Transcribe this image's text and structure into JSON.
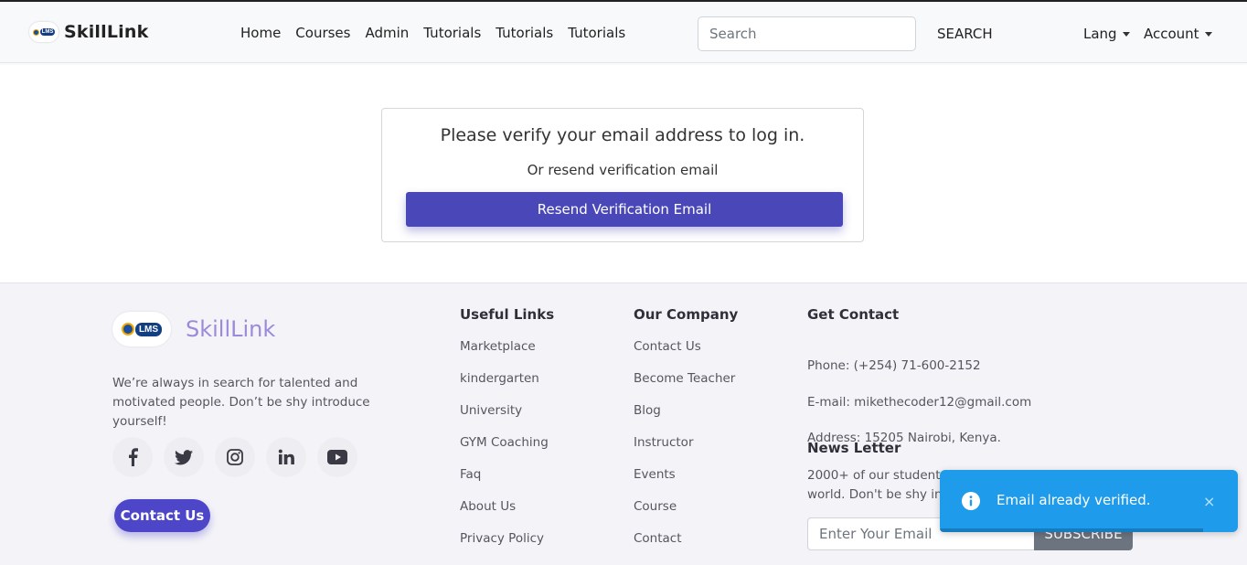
{
  "navbar": {
    "brand": "SkillLink",
    "logo_text": "LMS",
    "links": [
      "Home",
      "Courses",
      "Admin",
      "Tutorials",
      "Tutorials",
      "Tutorials"
    ],
    "search_placeholder": "Search",
    "search_button": "SEARCH",
    "lang_label": "Lang",
    "account_label": "Account"
  },
  "verify": {
    "title": "Please verify your email address to log in.",
    "subtitle": "Or resend verification email",
    "button": "Resend Verification Email"
  },
  "footer": {
    "brand": "SkillLink",
    "logo_text": "LMS",
    "tagline": "We’re always in search for talented and motivated people. Don’t be shy introduce yourself!",
    "socials": [
      "facebook-icon",
      "twitter-icon",
      "instagram-icon",
      "linkedin-icon",
      "youtube-icon"
    ],
    "contact_button": "Contact Us",
    "useful_links": {
      "title": "Useful Links",
      "items": [
        "Marketplace",
        "kindergarten",
        "University",
        "GYM Coaching",
        "Faq",
        "About Us",
        "Privacy Policy"
      ]
    },
    "our_company": {
      "title": "Our Company",
      "items": [
        "Contact Us",
        "Become Teacher",
        "Blog",
        "Instructor",
        "Events",
        "Course",
        "Contact"
      ]
    },
    "get_contact": {
      "title": "Get Contact",
      "phone": "Phone: (+254) 71-600-2152",
      "email": "E-mail: mikethecoder12@gmail.com",
      "address": "Address: 15205 Nairobi, Kenya."
    },
    "newsletter": {
      "title": "News Letter",
      "text": "2000+ of our students are subscribed around the world. Don't be shy introduce yourself!",
      "placeholder": "Enter Your Email",
      "button": "SUBSCRIBE"
    }
  },
  "toast": {
    "message": "Email already verified.",
    "close": "×",
    "color": "#1e9bea"
  }
}
